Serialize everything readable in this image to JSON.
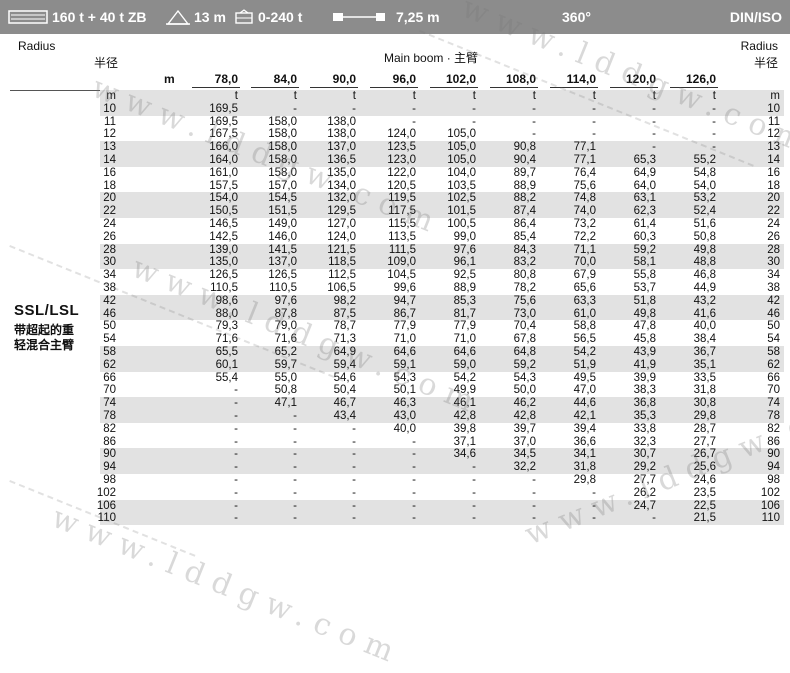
{
  "header_bar": {
    "counterweight": "160 t + 40 t ZB",
    "reach": "13 m",
    "range": "0-240 t",
    "width": "7,25 m",
    "slew": "360°",
    "standard": "DIN/ISO"
  },
  "table_header": {
    "radius_en": "Radius",
    "radius_cn": "半径",
    "boom_title": "Main boom · 主臂",
    "length_unit": "m",
    "boom_lengths": [
      "78,0",
      "84,0",
      "90,0",
      "96,0",
      "102,0",
      "108,0",
      "114,0",
      "120,0",
      "126,0"
    ]
  },
  "side_label": {
    "code": "SSL/LSL",
    "cn_line1": "带超起的重",
    "cn_line2": "轻混合主臂"
  },
  "watermark": "www.lddgw.com",
  "units_row": {
    "radius": "m",
    "values": [
      "t",
      "t",
      "t",
      "t",
      "t",
      "t",
      "t",
      "t",
      "t"
    ]
  },
  "rows": [
    {
      "r": "10",
      "v": [
        "169,5",
        "-",
        "-",
        "-",
        "-",
        "-",
        "-",
        "-",
        "-"
      ]
    },
    {
      "r": "11",
      "v": [
        "169,5",
        "158,0",
        "138,0",
        "-",
        "-",
        "-",
        "-",
        "-",
        "-"
      ]
    },
    {
      "r": "12",
      "v": [
        "167,5",
        "158,0",
        "138,0",
        "124,0",
        "105,0",
        "-",
        "-",
        "-",
        "-"
      ]
    },
    {
      "r": "13",
      "v": [
        "166,0",
        "158,0",
        "137,0",
        "123,5",
        "105,0",
        "90,8",
        "77,1",
        "-",
        "-"
      ]
    },
    {
      "r": "14",
      "v": [
        "164,0",
        "158,0",
        "136,5",
        "123,0",
        "105,0",
        "90,4",
        "77,1",
        "65,3",
        "55,2"
      ]
    },
    {
      "r": "16",
      "v": [
        "161,0",
        "158,0",
        "135,0",
        "122,0",
        "104,0",
        "89,7",
        "76,4",
        "64,9",
        "54,8"
      ]
    },
    {
      "r": "18",
      "v": [
        "157,5",
        "157,0",
        "134,0",
        "120,5",
        "103,5",
        "88,9",
        "75,6",
        "64,0",
        "54,0"
      ]
    },
    {
      "r": "20",
      "v": [
        "154,0",
        "154,5",
        "132,0",
        "119,5",
        "102,5",
        "88,2",
        "74,8",
        "63,1",
        "53,2"
      ]
    },
    {
      "r": "22",
      "v": [
        "150,5",
        "151,5",
        "129,5",
        "117,5",
        "101,5",
        "87,4",
        "74,0",
        "62,3",
        "52,4"
      ]
    },
    {
      "r": "24",
      "v": [
        "146,5",
        "149,0",
        "127,0",
        "115,5",
        "100,5",
        "86,4",
        "73,2",
        "61,4",
        "51,6"
      ]
    },
    {
      "r": "26",
      "v": [
        "142,5",
        "146,0",
        "124,0",
        "113,5",
        "99,0",
        "85,4",
        "72,2",
        "60,3",
        "50,8"
      ]
    },
    {
      "r": "28",
      "v": [
        "139,0",
        "141,5",
        "121,5",
        "111,5",
        "97,6",
        "84,3",
        "71,1",
        "59,2",
        "49,8"
      ]
    },
    {
      "r": "30",
      "v": [
        "135,0",
        "137,0",
        "118,5",
        "109,0",
        "96,1",
        "83,2",
        "70,0",
        "58,1",
        "48,8"
      ]
    },
    {
      "r": "34",
      "v": [
        "126,5",
        "126,5",
        "112,5",
        "104,5",
        "92,5",
        "80,8",
        "67,9",
        "55,8",
        "46,8"
      ]
    },
    {
      "r": "38",
      "v": [
        "110,5",
        "110,5",
        "106,5",
        "99,6",
        "88,9",
        "78,2",
        "65,6",
        "53,7",
        "44,9"
      ]
    },
    {
      "r": "42",
      "v": [
        "98,6",
        "97,6",
        "98,2",
        "94,7",
        "85,3",
        "75,6",
        "63,3",
        "51,8",
        "43,2"
      ]
    },
    {
      "r": "46",
      "v": [
        "88,0",
        "87,8",
        "87,5",
        "86,7",
        "81,7",
        "73,0",
        "61,0",
        "49,8",
        "41,6"
      ]
    },
    {
      "r": "50",
      "v": [
        "79,3",
        "79,0",
        "78,7",
        "77,9",
        "77,9",
        "70,4",
        "58,8",
        "47,8",
        "40,0"
      ]
    },
    {
      "r": "54",
      "v": [
        "71,6",
        "71,6",
        "71,3",
        "71,0",
        "71,0",
        "67,8",
        "56,5",
        "45,8",
        "38,4"
      ]
    },
    {
      "r": "58",
      "v": [
        "65,5",
        "65,2",
        "64,9",
        "64,6",
        "64,6",
        "64,8",
        "54,2",
        "43,9",
        "36,7"
      ]
    },
    {
      "r": "62",
      "v": [
        "60,1",
        "59,7",
        "59,4",
        "59,1",
        "59,0",
        "59,2",
        "51,9",
        "41,9",
        "35,1"
      ]
    },
    {
      "r": "66",
      "v": [
        "55,4",
        "55,0",
        "54,6",
        "54,3",
        "54,2",
        "54,3",
        "49,5",
        "39,9",
        "33,5"
      ]
    },
    {
      "r": "70",
      "v": [
        "-",
        "50,8",
        "50,4",
        "50,1",
        "49,9",
        "50,0",
        "47,0",
        "38,3",
        "31,8"
      ]
    },
    {
      "r": "74",
      "v": [
        "-",
        "47,1",
        "46,7",
        "46,3",
        "46,1",
        "46,2",
        "44,6",
        "36,8",
        "30,8"
      ]
    },
    {
      "r": "78",
      "v": [
        "-",
        "-",
        "43,4",
        "43,0",
        "42,8",
        "42,8",
        "42,1",
        "35,3",
        "29,8"
      ]
    },
    {
      "r": "82",
      "v": [
        "-",
        "-",
        "-",
        "40,0",
        "39,8",
        "39,7",
        "39,4",
        "33,8",
        "28,7"
      ]
    },
    {
      "r": "86",
      "v": [
        "-",
        "-",
        "-",
        "-",
        "37,1",
        "37,0",
        "36,6",
        "32,3",
        "27,7"
      ]
    },
    {
      "r": "90",
      "v": [
        "-",
        "-",
        "-",
        "-",
        "34,6",
        "34,5",
        "34,1",
        "30,7",
        "26,7"
      ]
    },
    {
      "r": "94",
      "v": [
        "-",
        "-",
        "-",
        "-",
        "-",
        "32,2",
        "31,8",
        "29,2",
        "25,6"
      ]
    },
    {
      "r": "98",
      "v": [
        "-",
        "-",
        "-",
        "-",
        "-",
        "-",
        "29,8",
        "27,7",
        "24,6"
      ]
    },
    {
      "r": "102",
      "v": [
        "-",
        "-",
        "-",
        "-",
        "-",
        "-",
        "-",
        "26,2",
        "23,5"
      ]
    },
    {
      "r": "106",
      "v": [
        "-",
        "-",
        "-",
        "-",
        "-",
        "-",
        "-",
        "24,7",
        "22,5"
      ]
    },
    {
      "r": "110",
      "v": [
        "-",
        "-",
        "-",
        "-",
        "-",
        "-",
        "-",
        "-",
        "21,5"
      ]
    }
  ]
}
